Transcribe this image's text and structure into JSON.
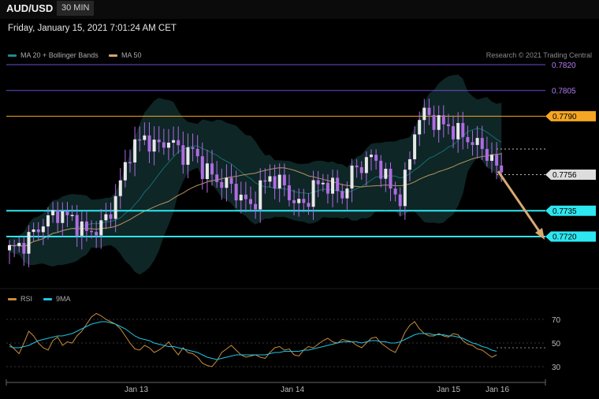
{
  "header": {
    "symbol": "AUD/USD",
    "timeframe": "30 MIN",
    "datetime": "Friday, January 15, 2021 7:01:24 AM CET",
    "credit": "Research © 2021 Trading Central"
  },
  "legend": {
    "items": [
      {
        "label": "MA 20 + Bollinger Bands",
        "color": "#1d8b8f"
      },
      {
        "label": "MA 50",
        "color": "#d4a373"
      }
    ]
  },
  "rsi_legend": {
    "items": [
      {
        "label": "RSI",
        "color": "#c98b3b"
      },
      {
        "label": "9MA",
        "color": "#1fc3e6"
      }
    ]
  },
  "colors": {
    "background": "#000000",
    "candle": "#e8e8e8",
    "candle_wick": "#b06be3",
    "band_fill": "#0f2a2a",
    "ma20": "#176e6e",
    "ma50": "#b8935e",
    "level_purple": "#6c4bd1",
    "level_orange": "#f5a623",
    "level_cyan": "#2ee6f0",
    "arrow": "#d9a870"
  },
  "chart_data": [
    {
      "type": "candlestick",
      "title": "AUD/USD",
      "ylim": [
        0.77,
        0.7823
      ],
      "x_ticks": [
        "Jan 13",
        "Jan 14",
        "Jan 15",
        "Jan 16"
      ],
      "series": [
        {
          "name": "MA 20 + Bollinger Bands",
          "kind": "bands"
        },
        {
          "name": "MA 50",
          "kind": "line"
        }
      ],
      "last_price": 0.7756,
      "levels": [
        {
          "value": 0.782,
          "label": "0.7820",
          "color": "#b57cf5",
          "kind": "line"
        },
        {
          "value": 0.7805,
          "label": "0.7805",
          "color": "#b57cf5",
          "kind": "line"
        },
        {
          "value": 0.779,
          "label": "0.7790",
          "color": "#f5a623",
          "kind": "tag"
        },
        {
          "value": 0.7756,
          "label": "0.7756",
          "color": "#dddddd",
          "kind": "tag"
        },
        {
          "value": 0.7735,
          "label": "0.7735",
          "color": "#2ee6f0",
          "kind": "tag"
        },
        {
          "value": 0.772,
          "label": "0.7720",
          "color": "#2ee6f0",
          "kind": "tag"
        }
      ],
      "projection": {
        "from": 0.7758,
        "to": 0.772
      }
    },
    {
      "type": "line",
      "title": "RSI",
      "ylim": [
        22,
        76
      ],
      "y_ticks": [
        70,
        50,
        30
      ],
      "series": [
        {
          "name": "RSI",
          "color": "#c98b3b",
          "values": [
            49,
            45,
            41,
            50,
            60,
            56,
            50,
            46,
            44,
            52,
            55,
            48,
            51,
            50,
            56,
            60,
            66,
            72,
            75,
            73,
            70,
            68,
            66,
            62,
            56,
            50,
            45,
            44,
            48,
            46,
            42,
            44,
            47,
            51,
            45,
            40,
            46,
            42,
            41,
            38,
            33,
            31,
            30,
            35,
            42,
            45,
            48,
            44,
            40,
            38,
            39,
            40,
            38,
            37,
            42,
            46,
            47,
            44,
            45,
            40,
            39,
            44,
            47,
            46,
            49,
            52,
            54,
            51,
            50,
            53,
            52,
            51,
            48,
            46,
            50,
            54,
            55,
            50,
            47,
            44,
            42,
            50,
            59,
            65,
            68,
            62,
            58,
            56,
            56,
            58,
            56,
            55,
            58,
            57,
            52,
            49,
            48,
            45,
            44,
            41,
            38,
            40
          ]
        },
        {
          "name": "9MA",
          "color": "#1fc3e6",
          "values": [
            47,
            46,
            46,
            47,
            48,
            50,
            52,
            53,
            54,
            55,
            56,
            56,
            57,
            58,
            60,
            62,
            64,
            66,
            67,
            68,
            68,
            67,
            66,
            64,
            62,
            59,
            56,
            54,
            53,
            52,
            50,
            49,
            48,
            47,
            47,
            46,
            45,
            44,
            43,
            42,
            40,
            38,
            37,
            36,
            37,
            38,
            39,
            40,
            40,
            40,
            40,
            40,
            40,
            40,
            41,
            42,
            42,
            43,
            43,
            43,
            43,
            44,
            44,
            45,
            46,
            47,
            48,
            49,
            50,
            51,
            51,
            51,
            51,
            50,
            51,
            52,
            52,
            51,
            51,
            50,
            50,
            51,
            53,
            55,
            57,
            58,
            58,
            58,
            57,
            57,
            57,
            56,
            56,
            55,
            54,
            52,
            50,
            49,
            47,
            46,
            44,
            43
          ]
        }
      ]
    }
  ]
}
